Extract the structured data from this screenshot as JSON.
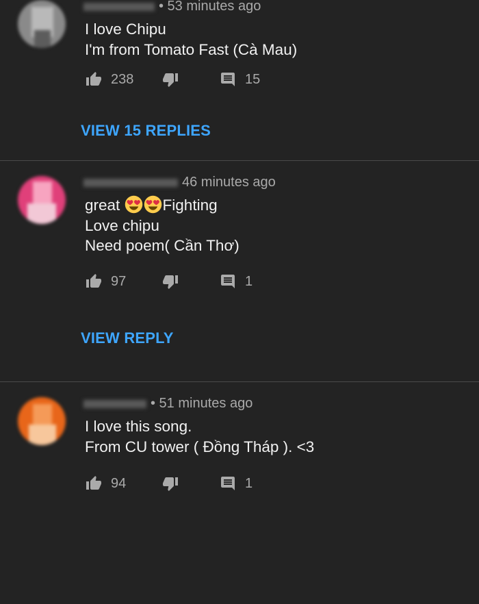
{
  "comments": [
    {
      "time": "• 53 minutes ago",
      "lines": [
        "I love Chipu",
        "I'm from Tomato Fast (Cà Mau)"
      ],
      "likes": "238",
      "replies": "15",
      "view_label": "VIEW 15 REPLIES",
      "avatar_colors": [
        "#8a8a8a",
        "#b9b9b9",
        "#5c5c5c"
      ]
    },
    {
      "time": "46 minutes ago",
      "line1_pre": "great ",
      "line1_post": "Fighting",
      "emojis": [
        "heart-eyes-emoji",
        "heart-eyes-emoji"
      ],
      "lines": [
        "Love chipu",
        "Need poem( Cần Thơ)"
      ],
      "likes": "97",
      "replies": "1",
      "view_label": "VIEW REPLY",
      "avatar_colors": [
        "#e0407a",
        "#f7a4c0",
        "#f2c8d6"
      ]
    },
    {
      "time": "• 51 minutes ago",
      "lines": [
        "I love this song.",
        "From CU tower ( Đồng Tháp ). <3"
      ],
      "likes": "94",
      "replies": "1",
      "avatar_colors": [
        "#e8661a",
        "#f59a58",
        "#f7c79c"
      ]
    }
  ],
  "colors": {
    "background": "#232323",
    "link": "#3ea6ff",
    "meta": "#aaaaaa"
  },
  "icons": [
    "thumbs-up-icon",
    "thumbs-down-icon",
    "reply-icon"
  ]
}
